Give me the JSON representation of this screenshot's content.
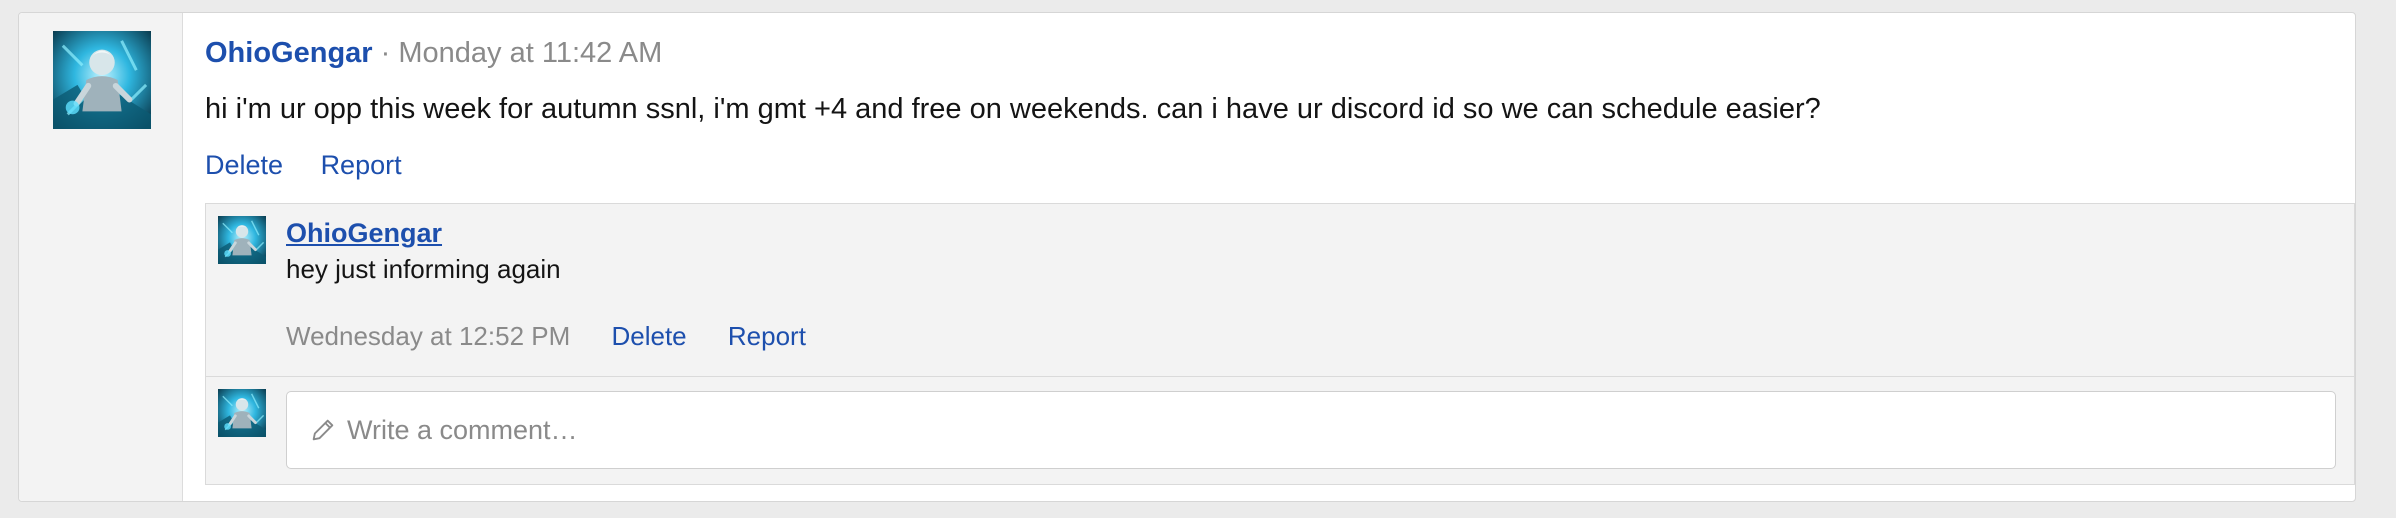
{
  "post": {
    "username": "OhioGengar",
    "separator": "·",
    "timestamp": "Monday at 11:42 AM",
    "message": "hi i'm ur opp this week for autumn ssnl, i'm gmt +4 and free on weekends. can i have ur discord id so we can schedule easier?",
    "actions": {
      "delete_label": "Delete",
      "report_label": "Report"
    }
  },
  "comments": [
    {
      "username": "OhioGengar",
      "text": "hey just informing again",
      "timestamp": "Wednesday at 12:52 PM",
      "delete_label": "Delete",
      "report_label": "Report"
    }
  ],
  "reply_box": {
    "placeholder": "Write a comment…",
    "icon": "pencil-icon"
  },
  "colors": {
    "link": "#1d4fad",
    "meta": "#8a8a8a",
    "text": "#141414",
    "panel": "#f3f3f3",
    "page_bg": "#ebebeb"
  },
  "avatar": {
    "description_icon": "user-avatar"
  }
}
